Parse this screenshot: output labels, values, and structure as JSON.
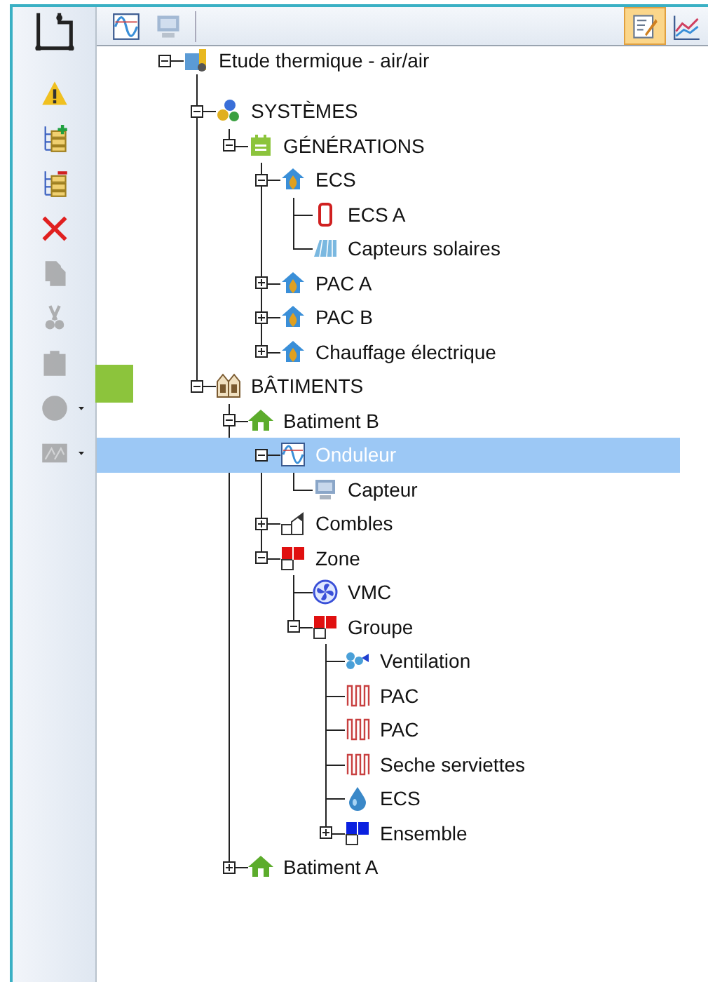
{
  "top_toolbar": {
    "left": [
      {
        "kind": "wave",
        "disabled": false
      },
      {
        "kind": "sensor",
        "disabled": true
      }
    ],
    "right": [
      {
        "kind": "edit",
        "selected": true
      },
      {
        "kind": "chart",
        "selected": false
      }
    ]
  },
  "side_toolbar": [
    {
      "kind": "warning",
      "disabled": false,
      "dropdown": false
    },
    {
      "kind": "tree-add",
      "disabled": false,
      "dropdown": false
    },
    {
      "kind": "tree-remove",
      "disabled": false,
      "dropdown": false
    },
    {
      "kind": "delete",
      "disabled": false,
      "dropdown": false
    },
    {
      "kind": "copy",
      "disabled": true,
      "dropdown": false
    },
    {
      "kind": "cut",
      "disabled": true,
      "dropdown": false
    },
    {
      "kind": "paste",
      "disabled": true,
      "dropdown": false
    },
    {
      "kind": "circle",
      "disabled": true,
      "dropdown": true
    },
    {
      "kind": "image",
      "disabled": true,
      "dropdown": true
    }
  ],
  "tree": {
    "label": "Etude thermique - air/air",
    "kind": "project",
    "expanded": true,
    "selected": false,
    "children": [
      {
        "label": "SYSTÈMES",
        "kind": "gears",
        "expanded": true,
        "selected": false,
        "children": [
          {
            "label": "GÉNÉRATIONS",
            "kind": "calendar",
            "expanded": true,
            "selected": false,
            "children": [
              {
                "label": "ECS",
                "kind": "heatpump",
                "expanded": true,
                "selected": false,
                "children": [
                  {
                    "label": "ECS A",
                    "kind": "tank",
                    "selected": false
                  },
                  {
                    "label": "Capteurs solaires",
                    "kind": "solar",
                    "selected": false
                  }
                ]
              },
              {
                "label": "PAC A",
                "kind": "heatpump",
                "expanded": false,
                "selected": false
              },
              {
                "label": "PAC B",
                "kind": "heatpump",
                "expanded": false,
                "selected": false
              },
              {
                "label": "Chauffage électrique",
                "kind": "heatpump",
                "expanded": false,
                "selected": false
              }
            ]
          }
        ]
      },
      {
        "label": "BÂTIMENTS",
        "kind": "buildings",
        "expanded": true,
        "selected": false,
        "children": [
          {
            "label": "Batiment B",
            "kind": "house",
            "expanded": true,
            "selected": false,
            "children": [
              {
                "label": "Onduleur",
                "kind": "wave",
                "expanded": true,
                "selected": true,
                "children": [
                  {
                    "label": "Capteur",
                    "kind": "sensor",
                    "selected": false
                  }
                ]
              },
              {
                "label": "Combles",
                "kind": "roof",
                "expanded": false,
                "selected": false
              },
              {
                "label": "Zone",
                "kind": "zone",
                "expanded": true,
                "selected": false,
                "children": [
                  {
                    "label": "VMC",
                    "kind": "fan",
                    "selected": false
                  },
                  {
                    "label": "Groupe",
                    "kind": "zone",
                    "expanded": true,
                    "selected": false,
                    "children": [
                      {
                        "label": "Ventilation",
                        "kind": "vent",
                        "selected": false
                      },
                      {
                        "label": "PAC",
                        "kind": "radiator",
                        "selected": false
                      },
                      {
                        "label": "PAC",
                        "kind": "radiator",
                        "selected": false
                      },
                      {
                        "label": "Seche serviettes",
                        "kind": "radiator",
                        "selected": false
                      },
                      {
                        "label": "ECS",
                        "kind": "drop",
                        "selected": false
                      },
                      {
                        "label": "Ensemble",
                        "kind": "group",
                        "expanded": false,
                        "selected": false
                      }
                    ]
                  }
                ]
              }
            ]
          },
          {
            "label": "Batiment A",
            "kind": "house",
            "expanded": false,
            "selected": false
          }
        ]
      }
    ]
  }
}
